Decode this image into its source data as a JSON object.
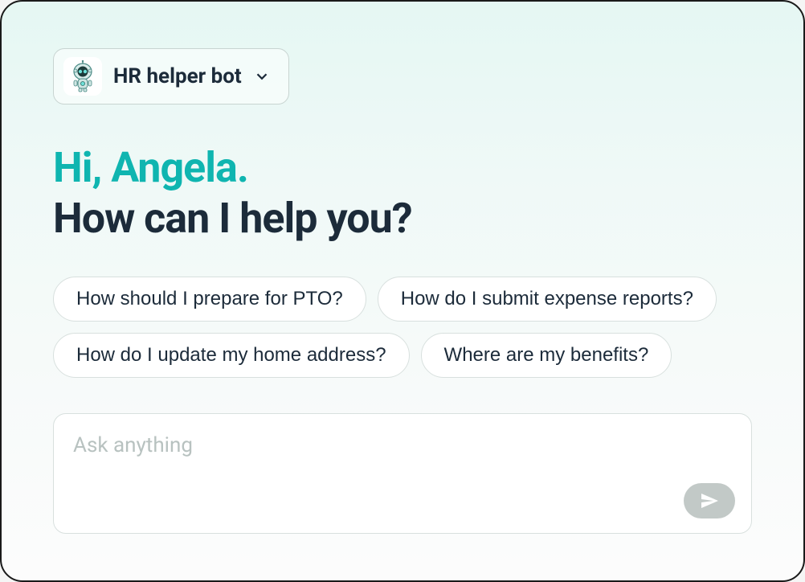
{
  "selector": {
    "bot_name": "HR helper bot"
  },
  "greeting": {
    "hi": "Hi, Angela.",
    "help": "How can I help you?"
  },
  "suggestions": [
    "How should I prepare for PTO?",
    "How do I submit expense reports?",
    "How do I update my home address?",
    "Where are my benefits?"
  ],
  "input": {
    "placeholder": "Ask anything"
  }
}
